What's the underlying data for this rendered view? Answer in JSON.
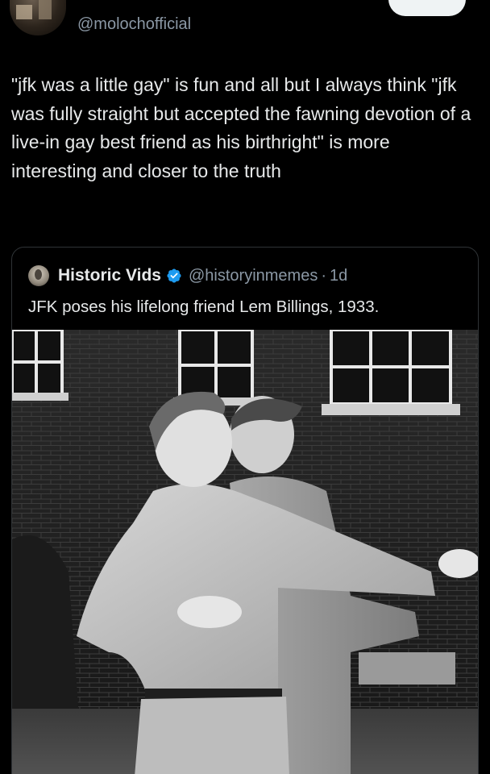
{
  "author": {
    "handle": "@molochofficial"
  },
  "tweet": {
    "text": "\"jfk was a little gay\" is fun and all but I always think \"jfk was fully straight but accepted the fawning devotion of a live-in gay best friend as his birthright\" is more interesting and closer to the truth"
  },
  "quote": {
    "name": "Historic Vids",
    "handle": "@historyinmemes",
    "separator": "·",
    "time": "1d",
    "text": "JFK poses his lifelong friend Lem Billings, 1933.",
    "verified_color": "#1d9bf0"
  },
  "colors": {
    "background": "#000000",
    "text": "#e7e9ea",
    "secondary": "#8b98a5",
    "border": "#2f3336"
  }
}
